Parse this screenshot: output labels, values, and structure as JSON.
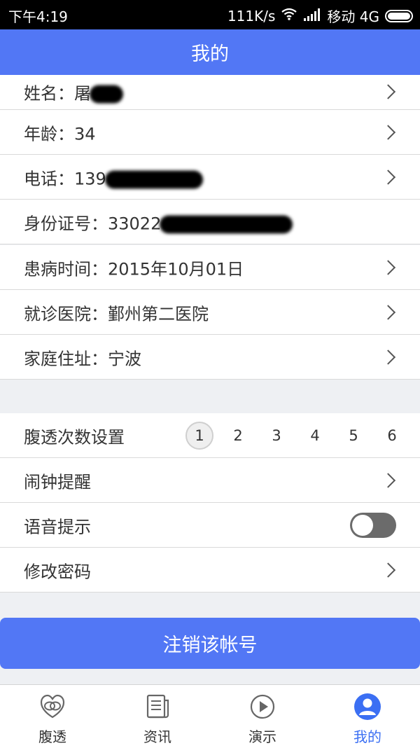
{
  "status_bar": {
    "time": "下午4:19",
    "speed": "111K/s",
    "carrier": "移动 4G"
  },
  "header": {
    "title": "我的"
  },
  "profile": [
    {
      "id": "name",
      "label": "姓名：",
      "value": "屠",
      "redacted": true,
      "chevron": true
    },
    {
      "id": "age",
      "label": "年龄：",
      "value": "34",
      "redacted": false,
      "chevron": true
    },
    {
      "id": "phone",
      "label": "电话：",
      "value": "139",
      "redacted": true,
      "chevron": true
    },
    {
      "id": "id-number",
      "label": "身份证号：",
      "value": "33022",
      "redacted": true,
      "chevron": false
    },
    {
      "id": "diagnosis-date",
      "label": "患病时间：",
      "value": "2015年10月01日",
      "redacted": false,
      "chevron": true
    },
    {
      "id": "hospital",
      "label": "就诊医院：",
      "value": "鄞州第二医院",
      "redacted": false,
      "chevron": true
    },
    {
      "id": "address",
      "label": "家庭住址：",
      "value": "宁波",
      "redacted": false,
      "chevron": true
    }
  ],
  "settings": {
    "frequency": {
      "label": "腹透次数设置",
      "options": [
        "1",
        "2",
        "3",
        "4",
        "5",
        "6"
      ],
      "selected": "1"
    },
    "alarm": {
      "label": "闹钟提醒"
    },
    "voice": {
      "label": "语音提示",
      "enabled": false
    },
    "password": {
      "label": "修改密码"
    }
  },
  "logout_label": "注销该帐号",
  "tabs": [
    {
      "label": "腹透",
      "icon": "peritoneal-icon",
      "active": false
    },
    {
      "label": "资讯",
      "icon": "news-icon",
      "active": false
    },
    {
      "label": "演示",
      "icon": "play-icon",
      "active": false
    },
    {
      "label": "我的",
      "icon": "user-icon",
      "active": true
    }
  ],
  "colors": {
    "primary": "#5277f5",
    "tab_active": "#3b6ff3",
    "background": "#eef0f3",
    "status_bar": "#000000"
  }
}
